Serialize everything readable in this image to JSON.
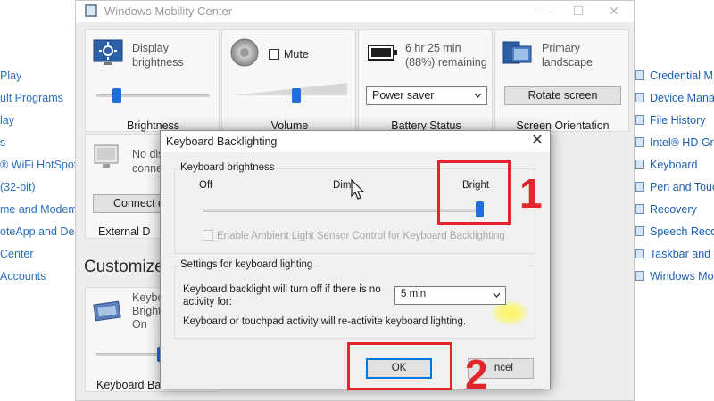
{
  "control_panel": {
    "left_items": [
      "Play",
      "ult Programs",
      "lay",
      "s",
      "® WiFi HotSpot",
      "(32-bit)",
      "me and Modem",
      "oteApp and Des",
      " Center",
      " Accounts"
    ],
    "right_items": [
      "Credential M",
      "Device Mana",
      "File History",
      "Intel® HD Gr",
      "Keyboard",
      "Pen and Touc",
      "Recovery",
      "Speech Recog",
      "Taskbar and N",
      "Windows Mob"
    ]
  },
  "mobility_center": {
    "title": "Windows Mobility Center",
    "tiles": {
      "brightness": {
        "label": "Display brightness",
        "footer": "Brightness",
        "level": 0.15
      },
      "volume": {
        "mute_label": "Mute",
        "footer": "Volume",
        "level": 0.55
      },
      "battery": {
        "label": "6 hr 25 min (88%) remaining",
        "select_value": "Power saver",
        "footer": "Battery Status"
      },
      "orientation": {
        "label": "Primary landscape",
        "button": "Rotate screen",
        "footer": "Screen Orientation"
      },
      "display": {
        "label": "No dis conne",
        "button": "Connect d",
        "footer": "External D"
      },
      "keyboard": {
        "label": "Keybo Bright On",
        "footer": "Keyboard Bac"
      }
    },
    "customize_heading": "Customize"
  },
  "dialog": {
    "title": "Keyboard Backlighting",
    "close_glyph": "✕",
    "brightness_group": {
      "label": "Keyboard brightness",
      "off": "Off",
      "dim": "Dim",
      "bright": "Bright",
      "level": 1.0,
      "ambient_label": "Enable Ambient Light Sensor Control for Keyboard Backlighting"
    },
    "settings_group": {
      "label": "Settings for keyboard lighting",
      "timeout_text": "Keyboard backlight will turn off if there is no activity for:",
      "timeout_value": "5 min",
      "note": "Keyboard or touchpad activity will re-activite keyboard lighting."
    },
    "ok_label": "OK",
    "cancel_label": "ncel"
  },
  "annotations": {
    "step1": "1",
    "step2": "2"
  },
  "colors": {
    "accent": "#1e6fd9",
    "annotation": "#e3262b"
  },
  "window_controls": {
    "minimize": "—",
    "maximize": "☐",
    "close": "✕"
  }
}
